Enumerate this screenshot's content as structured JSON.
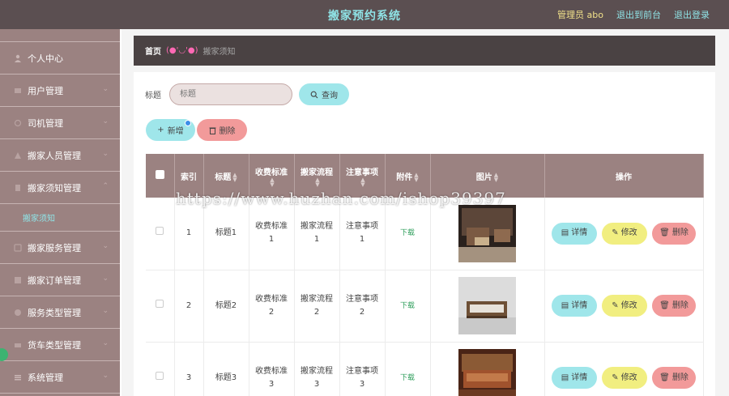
{
  "header": {
    "title": "搬家预约系统",
    "admin": "管理员 abo",
    "to_front": "退出到前台",
    "logout": "退出登录"
  },
  "sidebar": {
    "items": [
      {
        "label": "个人中心",
        "icon": "user-icon"
      },
      {
        "label": "用户管理",
        "icon": "users-icon"
      },
      {
        "label": "司机管理",
        "icon": "driver-icon"
      },
      {
        "label": "搬家人员管理",
        "icon": "mover-icon"
      },
      {
        "label": "搬家须知管理",
        "icon": "notice-icon"
      },
      {
        "label": "搬家服务管理",
        "icon": "service-icon"
      },
      {
        "label": "搬家订单管理",
        "icon": "order-icon"
      },
      {
        "label": "服务类型管理",
        "icon": "service-type-icon"
      },
      {
        "label": "货车类型管理",
        "icon": "truck-icon"
      },
      {
        "label": "系统管理",
        "icon": "system-icon"
      }
    ],
    "sub_active": "搬家须知"
  },
  "breadcrumb": {
    "home": "首页",
    "emoticon": "(●'◡'●)",
    "current": "搬家须知"
  },
  "search": {
    "label": "标题",
    "placeholder": "标题",
    "button": "查询"
  },
  "actions": {
    "add": "新增",
    "delete": "删除"
  },
  "table": {
    "headers": [
      "索引",
      "标题",
      "收费标准",
      "搬家流程",
      "注意事项",
      "附件",
      "图片",
      "操作"
    ],
    "rows": [
      {
        "index": "1",
        "title": "标题1",
        "fee_a": "收费标准",
        "fee_b": "1",
        "flow_a": "搬家流程",
        "flow_b": "1",
        "note_a": "注意事项",
        "note_b": "1",
        "attachment": "下载"
      },
      {
        "index": "2",
        "title": "标题2",
        "fee_a": "收费标准",
        "fee_b": "2",
        "flow_a": "搬家流程",
        "flow_b": "2",
        "note_a": "注意事项",
        "note_b": "2",
        "attachment": "下载"
      },
      {
        "index": "3",
        "title": "标题3",
        "fee_a": "收费标准",
        "fee_b": "3",
        "flow_a": "搬家流程",
        "flow_b": "3",
        "note_a": "注意事项",
        "note_b": "3",
        "attachment": "下载"
      }
    ],
    "op_detail": "详情",
    "op_edit": "修改",
    "op_delete": "删除"
  },
  "watermark": "https://www.huzhan.com/ishop39397"
}
